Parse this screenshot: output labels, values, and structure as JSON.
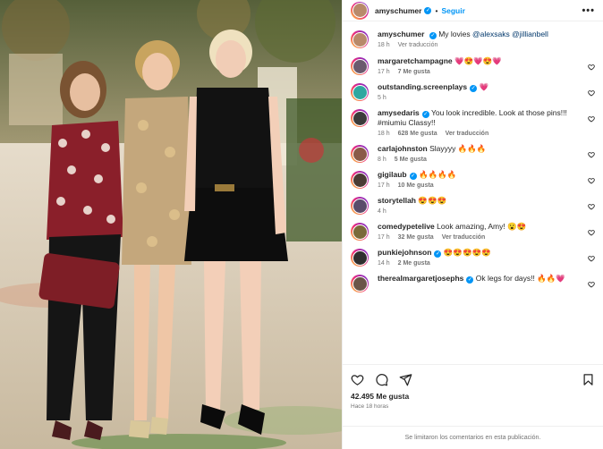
{
  "post": {
    "author": "amyschumer",
    "follow_label": "Seguir",
    "more_label": "•••",
    "caption": {
      "user": "amyschumer",
      "text": "My lovies ",
      "mentions": [
        "@alexsaks",
        "@jillianbell"
      ],
      "time": "18 h",
      "translate": "Ver traducción"
    },
    "likes": "42.495 Me gusta",
    "posted": "Hace 18 horas",
    "comments_closed": "Se limitaron los comentarios en esta publicación."
  },
  "comments": [
    {
      "user": "margaretchampagne",
      "verified": false,
      "text": "💗😍💗😍💗",
      "time": "17 h",
      "likes": "7 Me gusta",
      "extra": "",
      "avatar_color": "#6b5a6e"
    },
    {
      "user": "outstanding.screenplays",
      "verified": true,
      "text": "💗",
      "time": "5 h",
      "likes": "",
      "extra": "",
      "avatar_color": "#2fa7a0"
    },
    {
      "user": "amysedaris",
      "verified": true,
      "text": "You look incredible. Look at those pins!!! #miumiu Classy!!",
      "time": "18 h",
      "likes": "628 Me gusta",
      "extra": "Ver traducción",
      "avatar_color": "#3b3b3b"
    },
    {
      "user": "carlajohnston",
      "verified": false,
      "text": "Slayyyy 🔥🔥🔥",
      "time": "8 h",
      "likes": "5 Me gusta",
      "extra": "",
      "avatar_color": "#8a5a48"
    },
    {
      "user": "gigilaub",
      "verified": true,
      "text": "🔥🔥🔥🔥",
      "time": "17 h",
      "likes": "10 Me gusta",
      "extra": "",
      "avatar_color": "#4a3c34"
    },
    {
      "user": "storytellah",
      "verified": false,
      "text": "😍😍😍",
      "time": "4 h",
      "likes": "",
      "extra": "",
      "avatar_color": "#5a4c6a"
    },
    {
      "user": "comedypetelive",
      "verified": false,
      "text": "Look amazing, Amy! 😮😍",
      "time": "17 h",
      "likes": "32 Me gusta",
      "extra": "Ver traducción",
      "avatar_color": "#7a6a3a"
    },
    {
      "user": "punkiejohnson",
      "verified": true,
      "text": "😍😍😍😍😍",
      "time": "14 h",
      "likes": "2 Me gusta",
      "extra": "",
      "avatar_color": "#2f2f2f"
    },
    {
      "user": "therealmargaretjosephs",
      "verified": true,
      "text": "Ok legs for days!! 🔥🔥💗",
      "time": "",
      "likes": "",
      "extra": "",
      "avatar_color": "#6a5548"
    }
  ]
}
